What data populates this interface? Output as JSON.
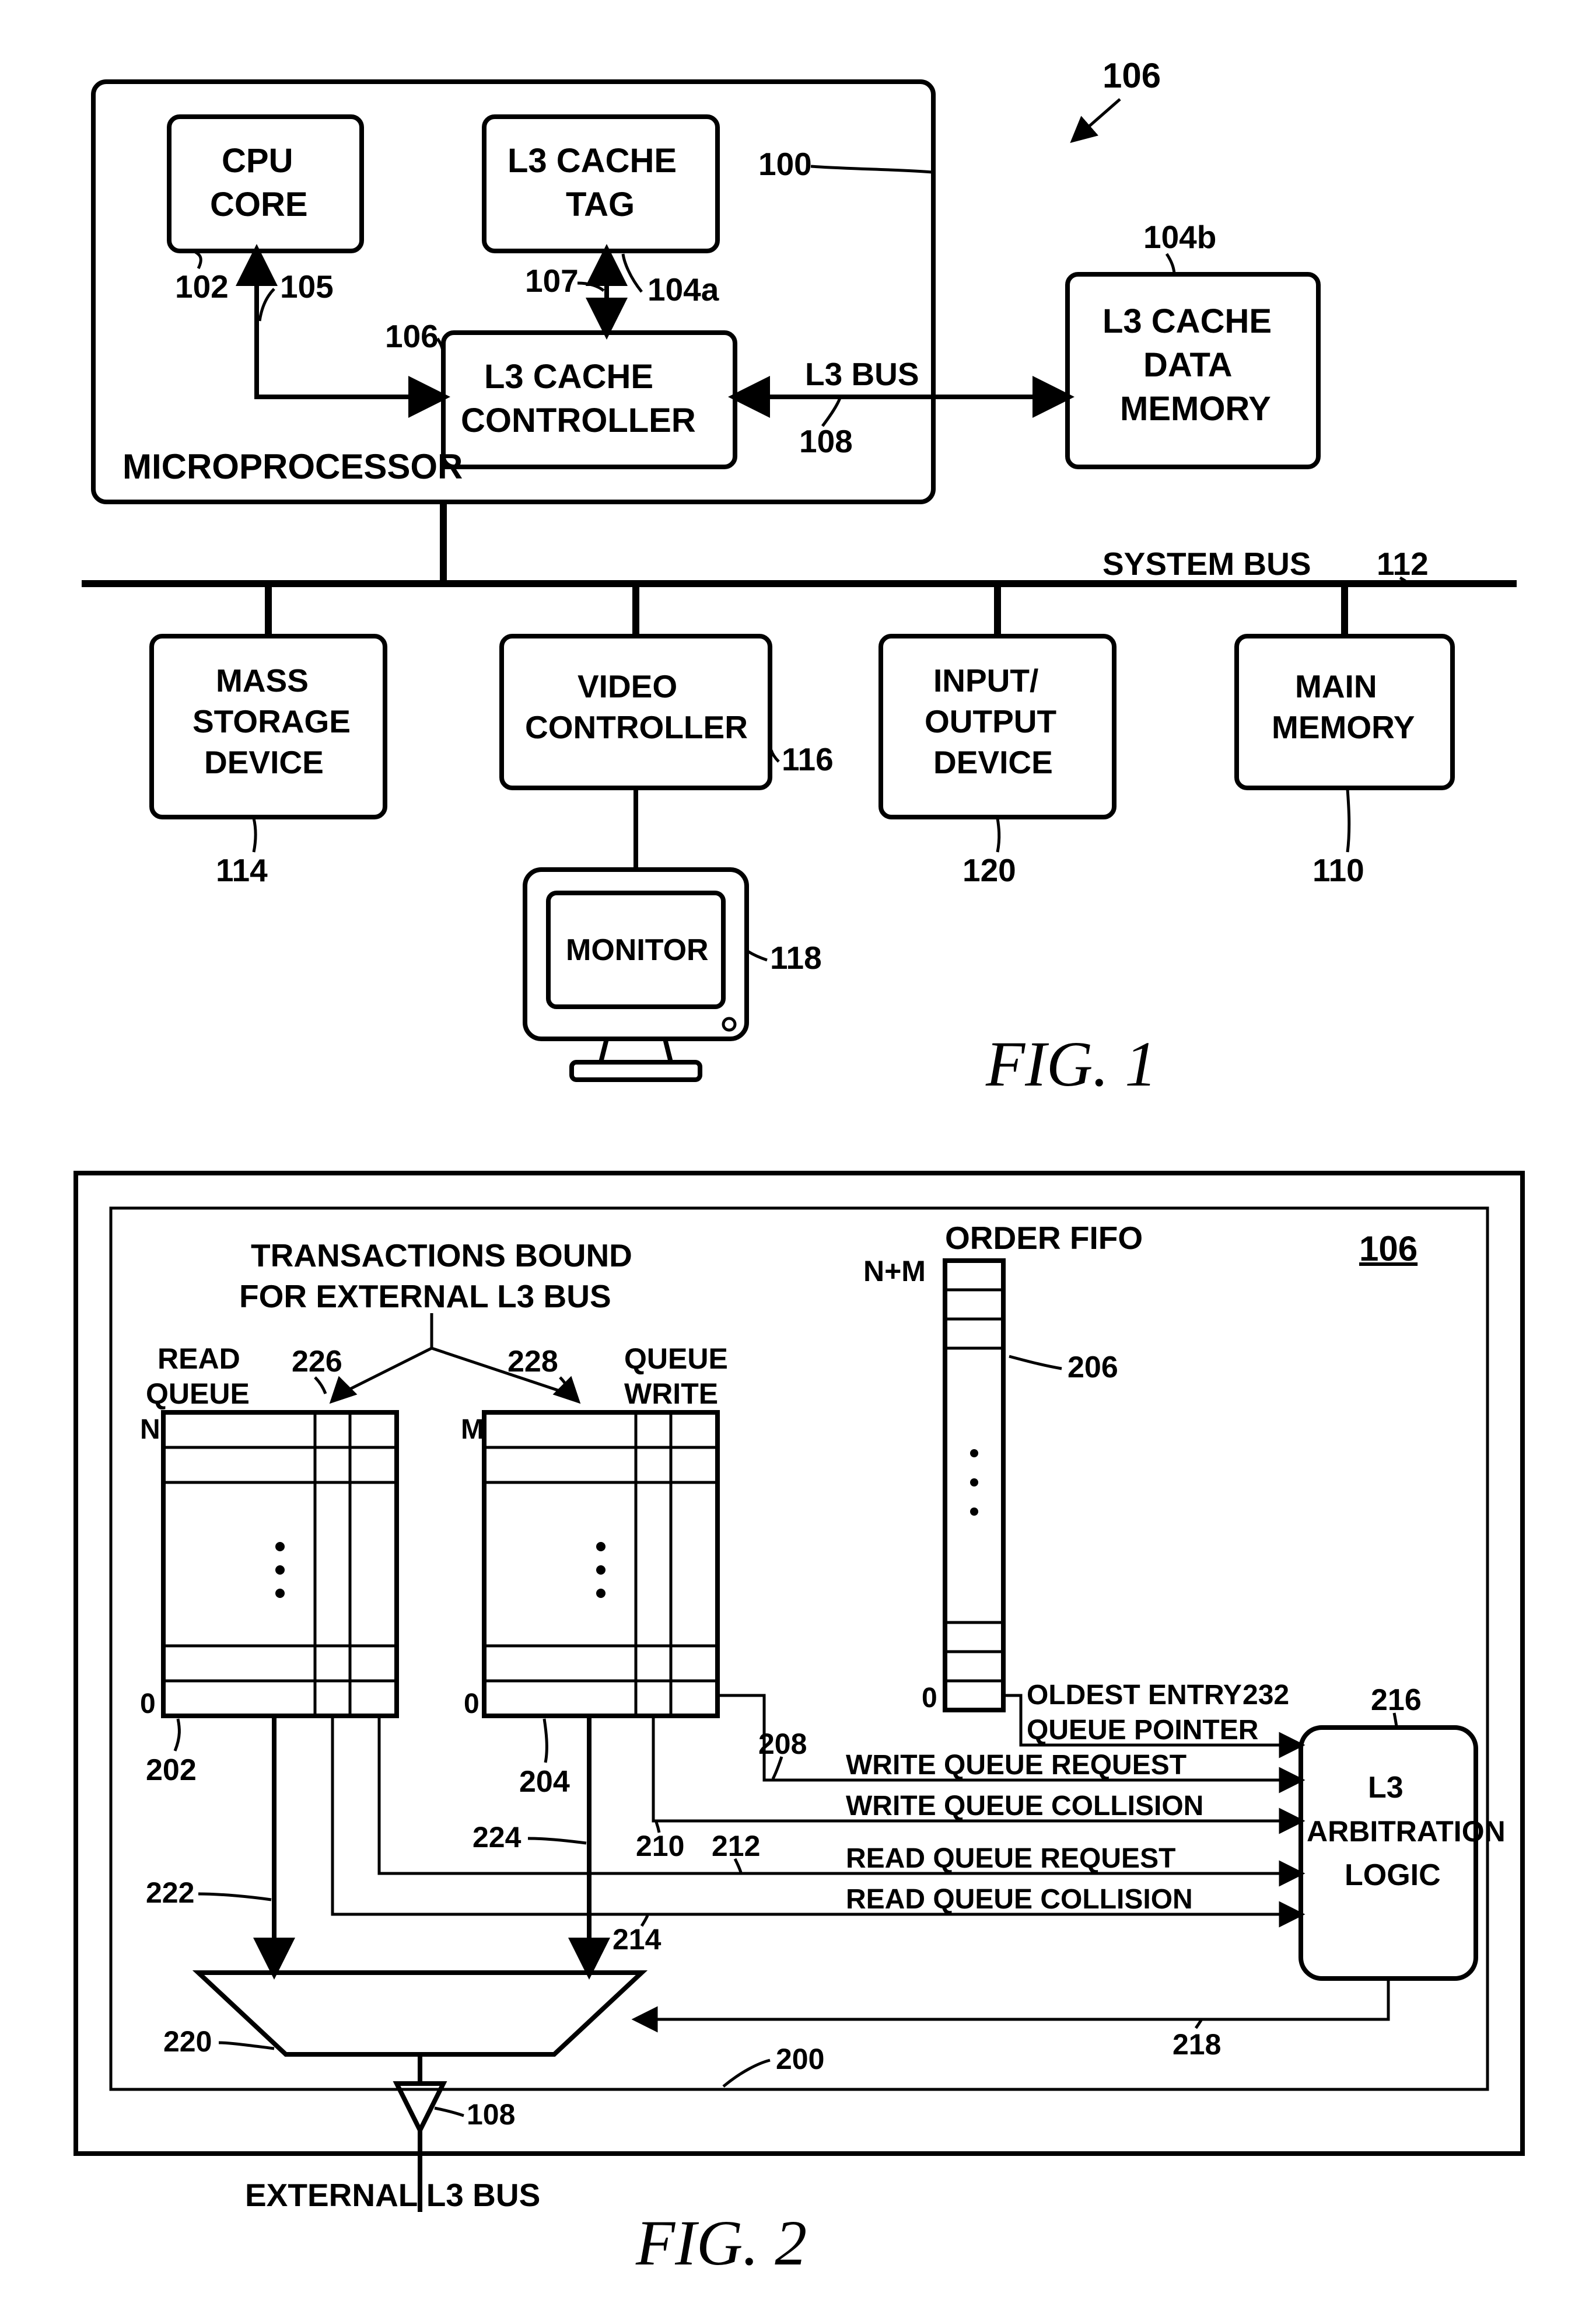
{
  "fig1": {
    "label": "FIG.  1",
    "microprocessor_label": "MICROPROCESSOR",
    "system_bus_label": "SYSTEM BUS",
    "l3_bus_label": "L3 BUS",
    "refs": {
      "r106_top": "106",
      "r100": "100",
      "r102": "102",
      "r104a": "104a",
      "r104b": "104b",
      "r105": "105",
      "r106": "106",
      "r107": "107",
      "r108": "108",
      "r112": "112",
      "r114": "114",
      "r116": "116",
      "r118": "118",
      "r120": "120",
      "r110": "110"
    },
    "blocks": {
      "cpu_core": [
        "CPU",
        "CORE"
      ],
      "l3_tag": [
        "L3 CACHE",
        "TAG"
      ],
      "l3_ctrl": [
        "L3 CACHE",
        "CONTROLLER"
      ],
      "l3_data": [
        "L3 CACHE",
        "DATA",
        "MEMORY"
      ],
      "mass_storage": [
        "MASS",
        "STORAGE",
        "DEVICE"
      ],
      "video_ctrl": [
        "VIDEO",
        "CONTROLLER"
      ],
      "io_device": [
        "INPUT/",
        "OUTPUT",
        "DEVICE"
      ],
      "main_mem": [
        "MAIN",
        "MEMORY"
      ],
      "monitor": "MONITOR"
    }
  },
  "fig2": {
    "label": "FIG.  2",
    "title": [
      "TRANSACTIONS BOUND",
      "FOR EXTERNAL L3 BUS"
    ],
    "read_queue_label": [
      "READ",
      "QUEUE"
    ],
    "write_queue_label": [
      "WRITE",
      "QUEUE"
    ],
    "order_fifo_label": "ORDER FIFO",
    "arb_label": [
      "L3",
      "ARBITRATION",
      "LOGIC"
    ],
    "ext_bus_label": "EXTERNAL L3 BUS",
    "signals": {
      "oldest_entry": "OLDEST ENTRY",
      "queue_ptr": "QUEUE POINTER",
      "wq_req": "WRITE QUEUE REQUEST",
      "wq_col": "WRITE QUEUE COLLISION",
      "rq_req": "READ QUEUE REQUEST",
      "rq_col": "READ QUEUE COLLISION"
    },
    "letters": {
      "N": "N",
      "M": "M",
      "zero": "0",
      "N_M": "N+M"
    },
    "refs": {
      "r106": "106",
      "r202": "202",
      "r204": "204",
      "r206": "206",
      "r208": "208",
      "r210": "210",
      "r212": "212",
      "r214": "214",
      "r216": "216",
      "r218": "218",
      "r220": "220",
      "r222": "222",
      "r224": "224",
      "r226": "226",
      "r228": "228",
      "r232": "232",
      "r200": "200",
      "r108": "108"
    }
  }
}
